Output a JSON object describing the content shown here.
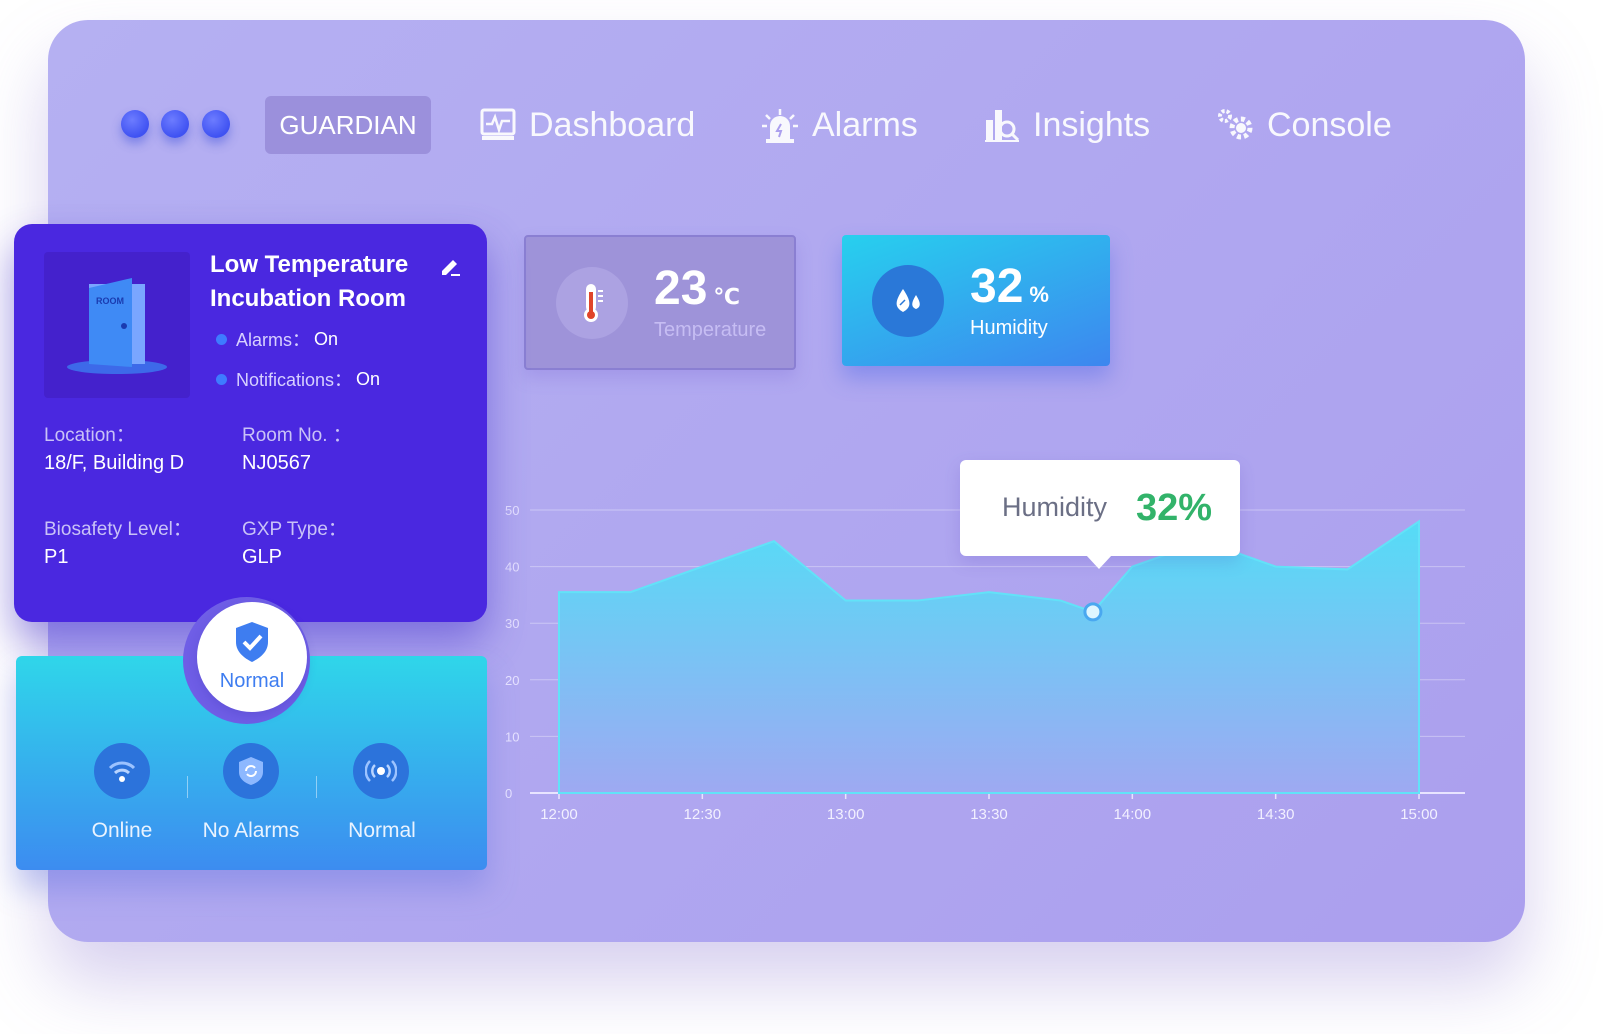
{
  "nav": {
    "brand": "GUARDIAN",
    "items": [
      {
        "label": "Dashboard",
        "icon": "monitor-icon"
      },
      {
        "label": "Alarms",
        "icon": "siren-icon"
      },
      {
        "label": "Insights",
        "icon": "analytics-icon"
      },
      {
        "label": "Console",
        "icon": "gears-icon"
      }
    ]
  },
  "room": {
    "title_line1": "Low Temperature",
    "title_line2": "Incubation Room",
    "image_text": "ROOM",
    "alarms_label": "Alarms：",
    "alarms_value": "On",
    "notifications_label": "Notifications：",
    "notifications_value": "On",
    "location_label": "Location：",
    "location_value": "18/F, Building D",
    "room_no_label": "Room No. ：",
    "room_no_value": "NJ0567",
    "biosafety_label": "Biosafety Level：",
    "biosafety_value": "P1",
    "gxp_label": "GXP Type：",
    "gxp_value": "GLP"
  },
  "status": {
    "overall": "Normal",
    "items": [
      {
        "label": "Online",
        "icon": "wifi-icon"
      },
      {
        "label": "No Alarms",
        "icon": "shield-sync-icon"
      },
      {
        "label": "Normal",
        "icon": "broadcast-icon"
      }
    ]
  },
  "metrics": {
    "temperature": {
      "value": "23",
      "unit": "℃",
      "label": "Temperature"
    },
    "humidity": {
      "value": "32",
      "unit": "%",
      "label": "Humidity"
    }
  },
  "tooltip": {
    "label": "Humidity",
    "value": "32%"
  },
  "colors": {
    "accent": "#4a28e0",
    "area_top": "#55dcf6",
    "area_bottom": "#9ea9f2",
    "tooltip_value": "#32b36a"
  },
  "chart_data": {
    "type": "area",
    "x": [
      "12:00",
      "12:15",
      "12:30",
      "12:45",
      "13:00",
      "13:15",
      "13:30",
      "13:45",
      "14:00",
      "14:15",
      "14:30",
      "14:45",
      "15:00"
    ],
    "xticks": [
      "12:00",
      "12:30",
      "13:00",
      "13:30",
      "14:00",
      "14:30",
      "15:00"
    ],
    "yticks": [
      "0",
      "10",
      "20",
      "30",
      "40",
      "50"
    ],
    "ylim": [
      0,
      50
    ],
    "series": [
      {
        "values": [
          35.5,
          35.5,
          40,
          44.5,
          34,
          34,
          35.5,
          34,
          40,
          44.5,
          40,
          39.5,
          48
        ]
      }
    ],
    "highlight": {
      "index": 7,
      "value": 32
    },
    "grid": true
  }
}
